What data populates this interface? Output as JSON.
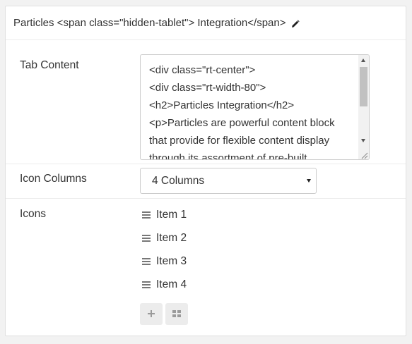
{
  "header": {
    "title": "Particles <span class=\"hidden-tablet\"> Integration</span>",
    "edit_icon": "pencil-icon"
  },
  "tab_content": {
    "label": "Tab Content",
    "lines": [
      "<div class=\"rt-center\">",
      "<div class=\"rt-width-80\">",
      "<h2>Particles Integration</h2>",
      "<p>Particles are powerful content block",
      "that provide for flexible content display",
      "through its assortment of pre-built"
    ]
  },
  "icon_columns": {
    "label": "Icon Columns",
    "selected": "4 Columns"
  },
  "icons": {
    "label": "Icons",
    "items": [
      "Item 1",
      "Item 2",
      "Item 3",
      "Item 4"
    ],
    "add_icon": "plus-icon",
    "bulk_icon": "grid-icon"
  }
}
